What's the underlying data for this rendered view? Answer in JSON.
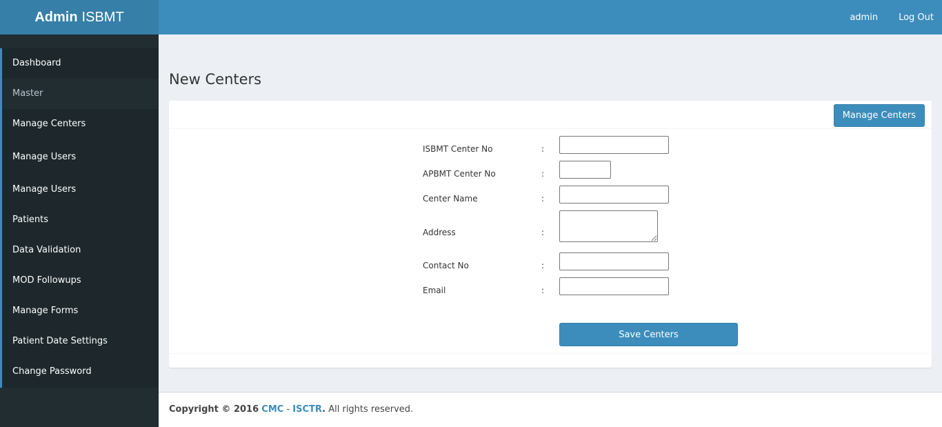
{
  "brand": {
    "bold": "Admin",
    "rest": "ISBMT"
  },
  "topbar": {
    "user": "admin",
    "logout": "Log Out"
  },
  "sidebar": {
    "items": [
      {
        "label": "Dashboard"
      },
      {
        "label": "Master"
      },
      {
        "label": "Manage Centers"
      },
      {
        "label": "Manage Users"
      },
      {
        "label": "Manage Users"
      },
      {
        "label": "Patients"
      },
      {
        "label": "Data Validation"
      },
      {
        "label": "MOD Followups"
      },
      {
        "label": "Manage Forms"
      },
      {
        "label": "Patient Date Settings"
      },
      {
        "label": "Change Password"
      }
    ]
  },
  "page": {
    "title": "New Centers"
  },
  "box": {
    "manage_button": "Manage Centers",
    "save_button": "Save Centers"
  },
  "form": {
    "isbmt_center_no": {
      "label": "ISBMT Center No",
      "colon": ":",
      "value": ""
    },
    "apbmt_center_no": {
      "label": "APBMT Center No",
      "colon": ":",
      "value": ""
    },
    "center_name": {
      "label": "Center Name",
      "colon": ":",
      "value": ""
    },
    "address": {
      "label": "Address",
      "colon": ":",
      "value": ""
    },
    "contact_no": {
      "label": "Contact No",
      "colon": ":",
      "value": ""
    },
    "email": {
      "label": "Email",
      "colon": ":",
      "value": ""
    }
  },
  "footer": {
    "prefix": "Copyright © 2016",
    "link1": "CMC",
    "sep": " - ",
    "link2": "ISCTR",
    "dot": ".",
    "suffix": " All rights reserved."
  },
  "colors": {
    "header": "#3c8dbc",
    "brand": "#367fa9",
    "sidebar": "#222d32",
    "accent": "#3c8dbc"
  }
}
